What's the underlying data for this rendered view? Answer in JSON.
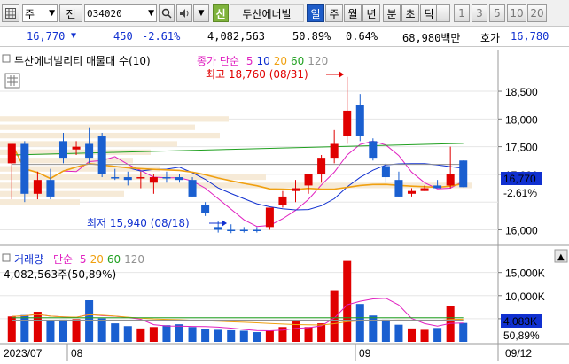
{
  "toolbar": {
    "grid_icon": "grid-icon",
    "market_type": "주",
    "stock_dropdown_label": "전",
    "stock_code": "034020",
    "search_icon": "search-icon",
    "speaker_icon": "speaker-icon",
    "new_badge": "신",
    "stock_name": "두산에너빌",
    "periods": [
      "일",
      "주",
      "월",
      "년",
      "분",
      "초",
      "틱"
    ],
    "active_period": "일",
    "minute_options": [
      "1",
      "3",
      "5",
      "10",
      "20"
    ]
  },
  "info": {
    "price": "16,770",
    "direction_icon": "down-triangle-icon",
    "change": "450",
    "change_pct": "-2.61%",
    "volume": "4,082,563",
    "volume_pct": "50.89%",
    "turnover": "0.64%",
    "amount": "68,980백만",
    "ask_label": "호가",
    "ask_price": "16,780"
  },
  "price_panel": {
    "title": "두산에너빌리티 매물대 수(10)",
    "legend_prefix": "종가 단순",
    "ma_periods": [
      "5",
      "10",
      "20",
      "60",
      "120"
    ],
    "ma_colors": [
      "#e020c0",
      "#1030d0",
      "#f0a010",
      "#20a020",
      "#909090"
    ],
    "high_label": "최고 18,760 (08/31)",
    "low_label": "최저 15,940 (08/18)",
    "y_ticks": [
      "18,500",
      "18,000",
      "17,500",
      "17,000",
      "16,000"
    ],
    "current_price_tag": "16,770",
    "current_pct_tag": "-2.61%"
  },
  "volume_panel": {
    "title": "거래량",
    "legend_prefix": "단순",
    "ma_periods": [
      "5",
      "20",
      "60",
      "120"
    ],
    "ma_colors": [
      "#e020c0",
      "#f0a010",
      "#20a020",
      "#909090"
    ],
    "summary": "4,082,563주(50,89%)",
    "y_ticks": [
      "15,000K",
      "10,000K",
      "5,000K"
    ],
    "current_volume_tag": "4,083K",
    "current_pct_tag": "50,89%"
  },
  "x_axis": {
    "labels": [
      "2023/07",
      "08",
      "09",
      "09/12"
    ]
  },
  "chart_data": {
    "type": "candlestick",
    "ylim": [
      15800,
      18900
    ],
    "candles": [
      {
        "o": 17200,
        "h": 17350,
        "l": 16550,
        "c": 17550
      },
      {
        "o": 17550,
        "h": 17600,
        "l": 16500,
        "c": 16650
      },
      {
        "o": 16650,
        "h": 17050,
        "l": 16550,
        "c": 16900
      },
      {
        "o": 16900,
        "h": 17100,
        "l": 16550,
        "c": 16600
      },
      {
        "o": 17300,
        "h": 17750,
        "l": 17200,
        "c": 17600
      },
      {
        "o": 17450,
        "h": 17600,
        "l": 17350,
        "c": 17500
      },
      {
        "o": 17300,
        "h": 17850,
        "l": 17200,
        "c": 17550
      },
      {
        "o": 17700,
        "h": 17750,
        "l": 16950,
        "c": 17000
      },
      {
        "o": 16950,
        "h": 17100,
        "l": 16900,
        "c": 16950
      },
      {
        "o": 16950,
        "h": 17050,
        "l": 16800,
        "c": 16900
      },
      {
        "o": 16950,
        "h": 17050,
        "l": 16750,
        "c": 16950
      },
      {
        "o": 16850,
        "h": 17000,
        "l": 16650,
        "c": 16950
      },
      {
        "o": 16950,
        "h": 17050,
        "l": 16850,
        "c": 16950
      },
      {
        "o": 16900,
        "h": 17000,
        "l": 16850,
        "c": 16950
      },
      {
        "o": 16900,
        "h": 16950,
        "l": 16600,
        "c": 16600
      },
      {
        "o": 16450,
        "h": 16500,
        "l": 16250,
        "c": 16300
      },
      {
        "o": 16050,
        "h": 16150,
        "l": 15950,
        "c": 16000
      },
      {
        "o": 16000,
        "h": 16100,
        "l": 15940,
        "c": 16000
      },
      {
        "o": 16000,
        "h": 16050,
        "l": 15950,
        "c": 16000
      },
      {
        "o": 16000,
        "h": 16050,
        "l": 15950,
        "c": 16000
      },
      {
        "o": 16050,
        "h": 16400,
        "l": 16000,
        "c": 16400
      },
      {
        "o": 16450,
        "h": 16700,
        "l": 16400,
        "c": 16600
      },
      {
        "o": 16700,
        "h": 16900,
        "l": 16500,
        "c": 16750
      },
      {
        "o": 16800,
        "h": 17000,
        "l": 16650,
        "c": 17000
      },
      {
        "o": 17000,
        "h": 17350,
        "l": 16850,
        "c": 17300
      },
      {
        "o": 17300,
        "h": 17800,
        "l": 17200,
        "c": 17550
      },
      {
        "o": 17700,
        "h": 18760,
        "l": 17550,
        "c": 18150
      },
      {
        "o": 18250,
        "h": 18450,
        "l": 17600,
        "c": 17700
      },
      {
        "o": 17600,
        "h": 17650,
        "l": 17250,
        "c": 17300
      },
      {
        "o": 17150,
        "h": 17200,
        "l": 16850,
        "c": 16950
      },
      {
        "o": 16900,
        "h": 17050,
        "l": 16600,
        "c": 16600
      },
      {
        "o": 16700,
        "h": 16750,
        "l": 16600,
        "c": 16650
      },
      {
        "o": 16700,
        "h": 16800,
        "l": 16700,
        "c": 16750
      },
      {
        "o": 16800,
        "h": 16900,
        "l": 16750,
        "c": 16750
      },
      {
        "o": 16800,
        "h": 17500,
        "l": 16750,
        "c": 17000
      },
      {
        "o": 16770,
        "h": 17250,
        "l": 16770,
        "c": 17250
      }
    ],
    "candle_up": [
      true,
      false,
      true,
      false,
      false,
      true,
      false,
      false,
      false,
      false,
      true,
      true,
      false,
      false,
      false,
      false,
      false,
      false,
      false,
      false,
      true,
      true,
      true,
      true,
      true,
      true,
      true,
      false,
      false,
      false,
      false,
      true,
      true,
      false,
      true,
      false
    ],
    "volume_k": [
      5500,
      5800,
      6500,
      4500,
      4800,
      4900,
      9000,
      5100,
      4000,
      3400,
      2900,
      3200,
      3600,
      3800,
      3200,
      2700,
      2600,
      2500,
      2400,
      2100,
      2400,
      3200,
      4400,
      3200,
      4000,
      11000,
      17500,
      8200,
      5700,
      4800,
      3700,
      2900,
      2600,
      3000,
      7800,
      4083
    ],
    "volume_ylim": [
      0,
      18000
    ]
  }
}
